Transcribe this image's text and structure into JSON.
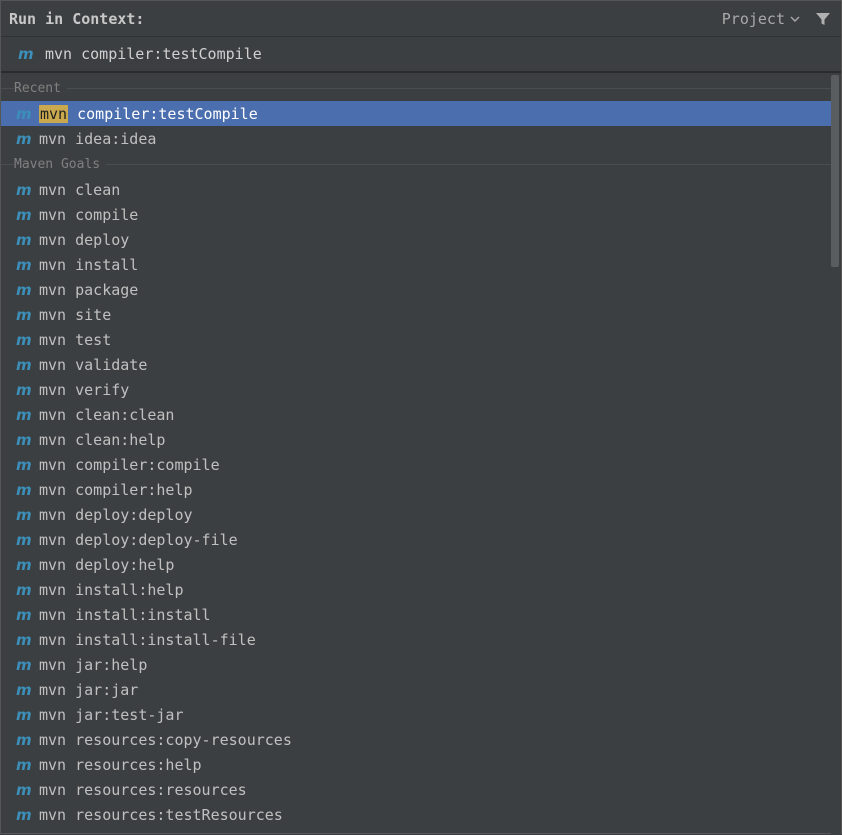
{
  "header": {
    "title": "Run in Context:",
    "project_label": "Project",
    "chevron_icon": "chevron-down-icon",
    "filter_icon": "filter-icon"
  },
  "search": {
    "icon": "maven-icon",
    "value": "mvn compiler:testCompile"
  },
  "groups": [
    {
      "label": "Recent",
      "items": [
        {
          "highlight": "mvn",
          "rest": " compiler:testCompile",
          "selected": true
        },
        {
          "highlight": "",
          "rest": "mvn idea:idea",
          "selected": false
        }
      ]
    },
    {
      "label": "Maven Goals",
      "items": [
        {
          "highlight": "",
          "rest": "mvn clean"
        },
        {
          "highlight": "",
          "rest": "mvn compile"
        },
        {
          "highlight": "",
          "rest": "mvn deploy"
        },
        {
          "highlight": "",
          "rest": "mvn install"
        },
        {
          "highlight": "",
          "rest": "mvn package"
        },
        {
          "highlight": "",
          "rest": "mvn site"
        },
        {
          "highlight": "",
          "rest": "mvn test"
        },
        {
          "highlight": "",
          "rest": "mvn validate"
        },
        {
          "highlight": "",
          "rest": "mvn verify"
        },
        {
          "highlight": "",
          "rest": "mvn clean:clean"
        },
        {
          "highlight": "",
          "rest": "mvn clean:help"
        },
        {
          "highlight": "",
          "rest": "mvn compiler:compile"
        },
        {
          "highlight": "",
          "rest": "mvn compiler:help"
        },
        {
          "highlight": "",
          "rest": "mvn deploy:deploy"
        },
        {
          "highlight": "",
          "rest": "mvn deploy:deploy-file"
        },
        {
          "highlight": "",
          "rest": "mvn deploy:help"
        },
        {
          "highlight": "",
          "rest": "mvn install:help"
        },
        {
          "highlight": "",
          "rest": "mvn install:install"
        },
        {
          "highlight": "",
          "rest": "mvn install:install-file"
        },
        {
          "highlight": "",
          "rest": "mvn jar:help"
        },
        {
          "highlight": "",
          "rest": "mvn jar:jar"
        },
        {
          "highlight": "",
          "rest": "mvn jar:test-jar"
        },
        {
          "highlight": "",
          "rest": "mvn resources:copy-resources"
        },
        {
          "highlight": "",
          "rest": "mvn resources:help"
        },
        {
          "highlight": "",
          "rest": "mvn resources:resources"
        },
        {
          "highlight": "",
          "rest": "mvn resources:testResources"
        }
      ]
    }
  ],
  "colors": {
    "background": "#3c3f41",
    "selection": "#4b6eaf",
    "match_highlight": "#c9a84e",
    "maven_icon": "#3b8fb8"
  }
}
